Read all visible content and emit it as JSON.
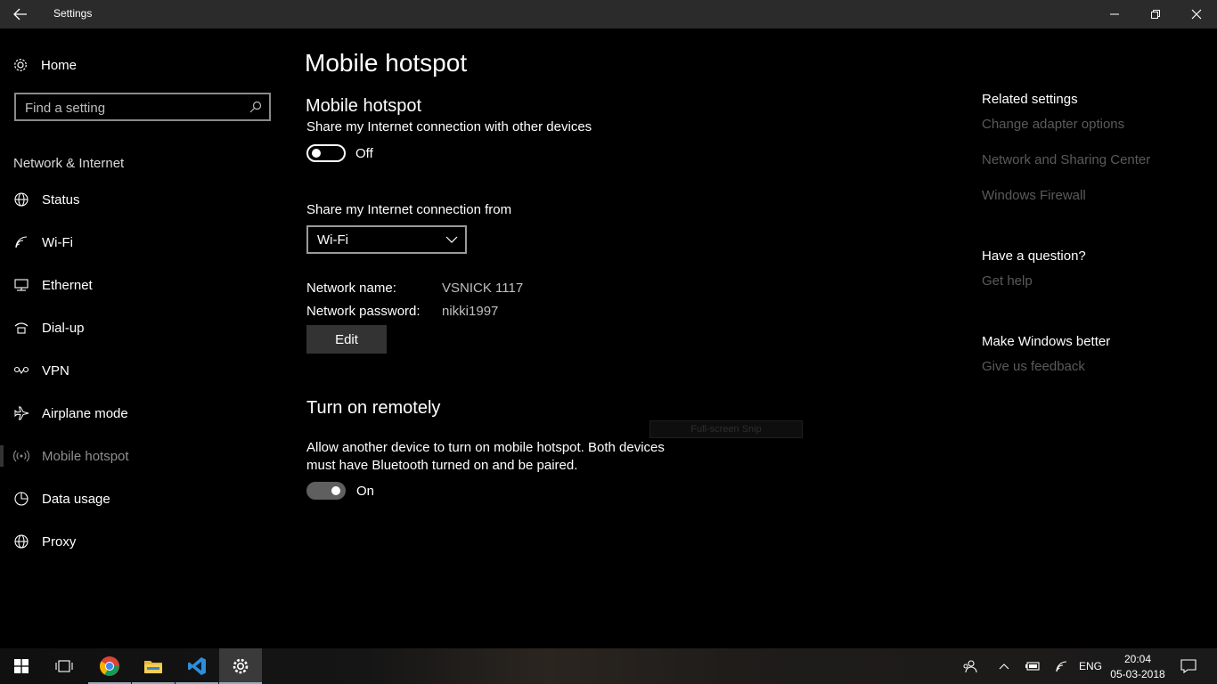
{
  "window": {
    "title": "Settings"
  },
  "sidebar": {
    "home_label": "Home",
    "search_placeholder": "Find a setting",
    "section_label": "Network & Internet",
    "items": [
      {
        "label": "Status",
        "icon": "globe-icon"
      },
      {
        "label": "Wi-Fi",
        "icon": "wifi-icon"
      },
      {
        "label": "Ethernet",
        "icon": "ethernet-icon"
      },
      {
        "label": "Dial-up",
        "icon": "dialup-icon"
      },
      {
        "label": "VPN",
        "icon": "vpn-icon"
      },
      {
        "label": "Airplane mode",
        "icon": "airplane-icon"
      },
      {
        "label": "Mobile hotspot",
        "icon": "hotspot-icon",
        "active": true
      },
      {
        "label": "Data usage",
        "icon": "data-usage-icon"
      },
      {
        "label": "Proxy",
        "icon": "globe-icon"
      }
    ]
  },
  "main": {
    "page_title": "Mobile hotspot",
    "hotspot": {
      "heading": "Mobile hotspot",
      "share_label": "Share my Internet connection with other devices",
      "toggle_state": "Off",
      "share_from_label": "Share my Internet connection from",
      "share_from_value": "Wi-Fi",
      "network_name_label": "Network name:",
      "network_name_value": "VSNICK 1117",
      "network_password_label": "Network password:",
      "network_password_value": "nikki1997",
      "edit_label": "Edit"
    },
    "remote": {
      "heading": "Turn on remotely",
      "description": "Allow another device to turn on mobile hotspot. Both devices must have Bluetooth turned on and be paired.",
      "toggle_state": "On"
    },
    "snip_tooltip": "Full-screen Snip"
  },
  "related": {
    "related_heading": "Related settings",
    "links": [
      "Change adapter options",
      "Network and Sharing Center",
      "Windows Firewall"
    ],
    "question_heading": "Have a question?",
    "help_link": "Get help",
    "better_heading": "Make Windows better",
    "feedback_link": "Give us feedback"
  },
  "taskbar": {
    "language": "ENG",
    "time": "20:04",
    "date": "05-03-2018"
  },
  "colors": {
    "background": "#000000",
    "titlebar": "#2b2b2b",
    "link_dim": "#5a5a5a",
    "toggle_on": "#5f5f5f"
  }
}
